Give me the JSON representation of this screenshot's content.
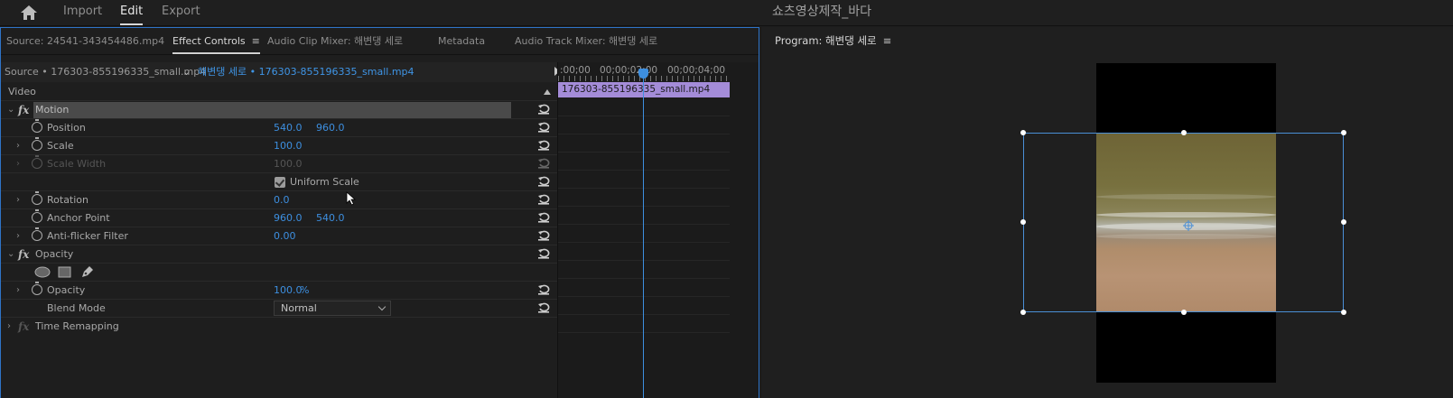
{
  "topbar": {
    "nav": [
      "Import",
      "Edit",
      "Export"
    ],
    "active": "Edit",
    "project_title": "쇼츠영상제작_바다"
  },
  "left_tabs": [
    {
      "label": "Source: 24541-343454486.mp4"
    },
    {
      "label": "Effect Controls",
      "menu": "≡"
    },
    {
      "label": "Audio Clip Mixer: 해변댕 세로"
    },
    {
      "label": "Metadata"
    },
    {
      "label": "Audio Track Mixer: 해변댕 세로"
    }
  ],
  "source_row": {
    "source": "Source • 176303-855196335_small.mp4",
    "chevron": "⌄",
    "sequence": "해변댕 세로 • 176303-855196335_small.mp4"
  },
  "video_header": "Video",
  "effects": {
    "motion": "Motion",
    "position": {
      "label": "Position",
      "x": "540.0",
      "y": "960.0"
    },
    "scale": {
      "label": "Scale",
      "value": "100.0"
    },
    "scale_width": {
      "label": "Scale Width",
      "value": "100.0"
    },
    "uniform_scale": {
      "label": "Uniform Scale",
      "checked": true
    },
    "rotation": {
      "label": "Rotation",
      "value": "0.0"
    },
    "anchor_point": {
      "label": "Anchor Point",
      "x": "960.0",
      "y": "540.0"
    },
    "anti_flicker": {
      "label": "Anti-flicker Filter",
      "value": "0.00"
    },
    "opacity_group": "Opacity",
    "opacity": {
      "label": "Opacity",
      "value": "100.0",
      "unit": "%"
    },
    "blend_mode": {
      "label": "Blend Mode",
      "value": "Normal"
    },
    "time_remapping": "Time Remapping",
    "fx_label": "fx"
  },
  "timeline": {
    "tc_start": ":00;00",
    "tc_mid": "00;00;02;00",
    "tc_end": "00;00;04;00",
    "clip": "176303-855196335_small.mp4",
    "clip_color": "#a48cd8",
    "playhead_color": "#3d8fe0"
  },
  "program": {
    "title": "Program: 해변댕 세로",
    "menu": "≡"
  },
  "colors": {
    "accent": "#3d8fe0",
    "panel_border": "#2e74c8"
  }
}
